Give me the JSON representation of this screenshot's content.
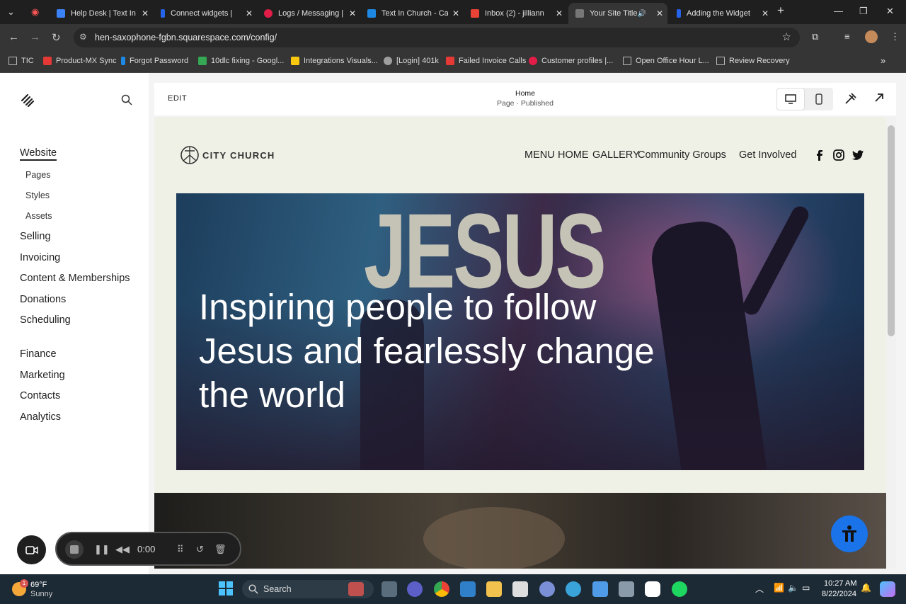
{
  "browser": {
    "tabs": [
      {
        "title": "Help Desk | Text In",
        "color": "#3b82f6"
      },
      {
        "title": "Connect widgets | ",
        "color": "#2563eb"
      },
      {
        "title": "Logs / Messaging |",
        "color": "#e11d48"
      },
      {
        "title": "Text In Church - Ca",
        "color": "#1e88e5"
      },
      {
        "title": "Inbox (2) - jilliann",
        "color": "#ea4335"
      },
      {
        "title": "Your Site Title",
        "color": "#777777"
      },
      {
        "title": "Adding the Widget",
        "color": "#2563eb"
      }
    ],
    "url": "hen-saxophone-fgbn.squarespace.com/config/",
    "bookmarks": [
      {
        "label": "TIC",
        "color": "#888888"
      },
      {
        "label": "Product-MX Sync",
        "color": "#e53935"
      },
      {
        "label": "Forgot Password",
        "color": "#1e88e5"
      },
      {
        "label": "10dlc fixing - Googl...",
        "color": "#34a853"
      },
      {
        "label": "Integrations Visuals...",
        "color": "#f9c80e"
      },
      {
        "label": "[Login] 401k",
        "color": "#9e9e9e"
      },
      {
        "label": "Failed Invoice Calls",
        "color": "#e53935"
      },
      {
        "label": "Customer profiles |...",
        "color": "#e11d48"
      },
      {
        "label": "Open Office Hour L...",
        "color": "#888888"
      },
      {
        "label": "Review Recovery",
        "color": "#888888"
      }
    ]
  },
  "sidebar": {
    "website": "Website",
    "sub": [
      "Pages",
      "Styles",
      "Assets"
    ],
    "items": [
      "Selling",
      "Invoicing",
      "Content & Memberships",
      "Donations",
      "Scheduling"
    ],
    "items2": [
      "Finance",
      "Marketing",
      "Contacts",
      "Analytics"
    ]
  },
  "editor": {
    "edit_label": "EDIT",
    "page_title": "Home",
    "page_status": "Page · Published"
  },
  "site": {
    "brand": "CITY CHURCH",
    "nav": [
      "MENU",
      "HOME",
      "GALLERY",
      "Community Groups",
      "Get Involved"
    ],
    "hero_sign": "JESUS",
    "hero_lines": [
      "Inspiring people to follow",
      "Jesus and fearlessly change",
      "the world"
    ]
  },
  "recorder": {
    "time": "0:00"
  },
  "taskbar": {
    "temp": "69°F",
    "weather": "Sunny",
    "weather_badge": "1",
    "search_placeholder": "Search",
    "time": "10:27 AM",
    "date": "8/22/2024"
  }
}
